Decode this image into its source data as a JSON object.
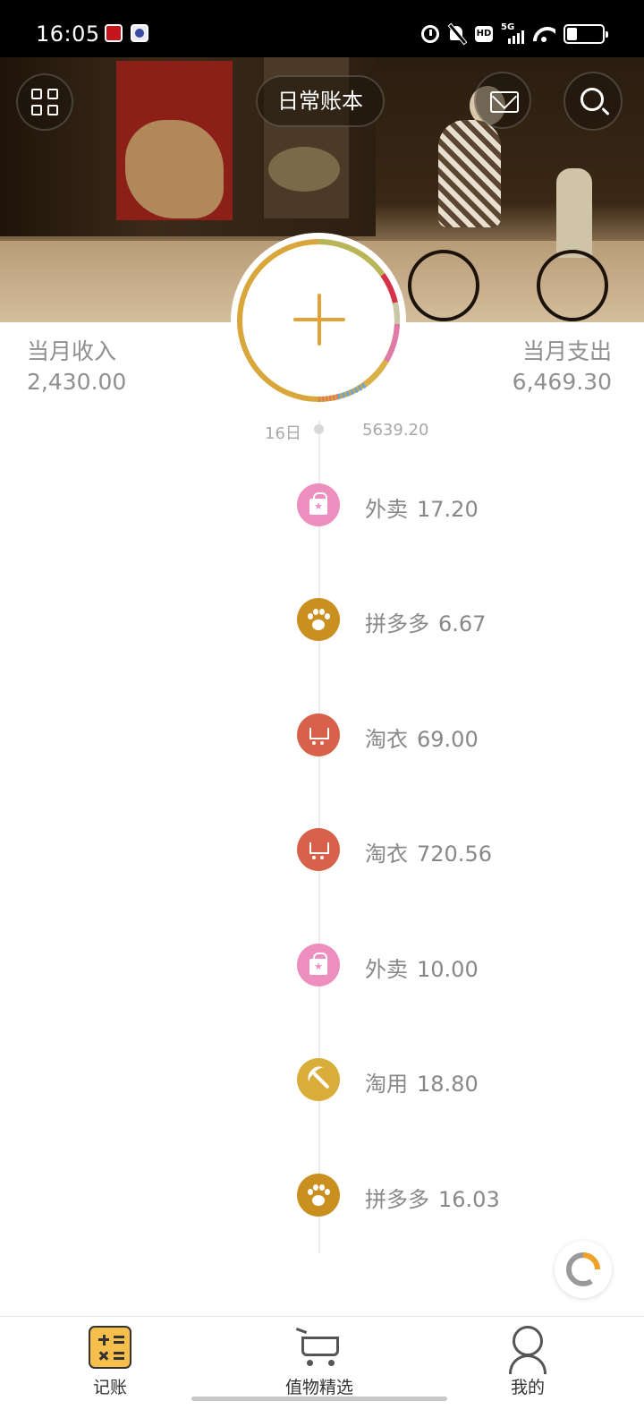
{
  "status_bar": {
    "time": "16:05",
    "network": "5G"
  },
  "header": {
    "book_name": "日常账本",
    "grid_icon": "grid-icon",
    "mail_icon": "mail-icon",
    "search_icon": "search-icon"
  },
  "summary": {
    "income_label": "当月收入",
    "income_value": "2,430.00",
    "expense_label": "当月支出",
    "expense_value": "6,469.30"
  },
  "add_button": {
    "icon": "plus-icon",
    "accent_color": "#e0a33b"
  },
  "timeline": {
    "date": "16日",
    "day_total": "5639.20",
    "entries": [
      {
        "category": "外卖",
        "amount": "17.20",
        "icon": "shopping-bag-icon",
        "color": "#ec8fbf"
      },
      {
        "category": "拼多多",
        "amount": "6.67",
        "icon": "paw-icon",
        "color": "#c98f1f"
      },
      {
        "category": "淘衣",
        "amount": "69.00",
        "icon": "cart-icon",
        "color": "#d8614c"
      },
      {
        "category": "淘衣",
        "amount": "720.56",
        "icon": "cart-icon",
        "color": "#d8614c"
      },
      {
        "category": "外卖",
        "amount": "10.00",
        "icon": "shopping-bag-icon",
        "color": "#ec8fbf"
      },
      {
        "category": "淘用",
        "amount": "18.80",
        "icon": "pickaxe-icon",
        "color": "#d9ad3a"
      },
      {
        "category": "拼多多",
        "amount": "16.03",
        "icon": "paw-icon",
        "color": "#c98f1f"
      }
    ]
  },
  "bottom_nav": {
    "items": [
      {
        "label": "记账",
        "icon": "calculator-icon",
        "active": true
      },
      {
        "label": "值物精选",
        "icon": "cart-icon",
        "active": false
      },
      {
        "label": "我的",
        "icon": "user-icon",
        "active": false
      }
    ]
  }
}
